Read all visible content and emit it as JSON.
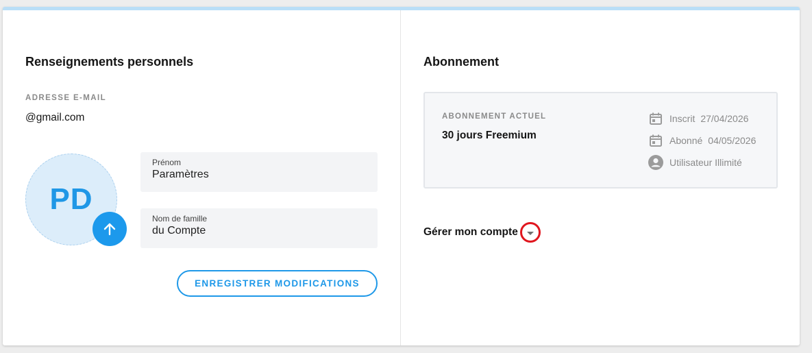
{
  "personal": {
    "title": "Renseignements personnels",
    "email_label": "ADRESSE E-MAIL",
    "email_value": "@gmail.com",
    "avatar_initials": "PD",
    "first_name_label": "Prénom",
    "first_name_value": "Paramètres",
    "last_name_label": "Nom de famille",
    "last_name_value": "du Compte",
    "save_button": "ENREGISTRER MODIFICATIONS"
  },
  "subscription": {
    "title": "Abonnement",
    "current_label": "ABONNEMENT ACTUEL",
    "plan": "30 jours Freemium",
    "registered_label": "Inscrit",
    "registered_date": "27/04/2026",
    "subscribed_label": "Abonné",
    "subscribed_date": "04/05/2026",
    "user_type": "Utilisateur Illimité",
    "manage_label": "Gérer mon compte"
  },
  "icons": {
    "upload": "arrow-up-icon",
    "registered": "calendar-icon",
    "subscribed": "calendar-icon",
    "user": "user-icon",
    "manage": "chevron-down-icon"
  },
  "colors": {
    "accent": "#1e98e8",
    "top_border": "#b9def7",
    "avatar_bg": "#dcedfa",
    "highlight_circle": "#e0161e"
  }
}
